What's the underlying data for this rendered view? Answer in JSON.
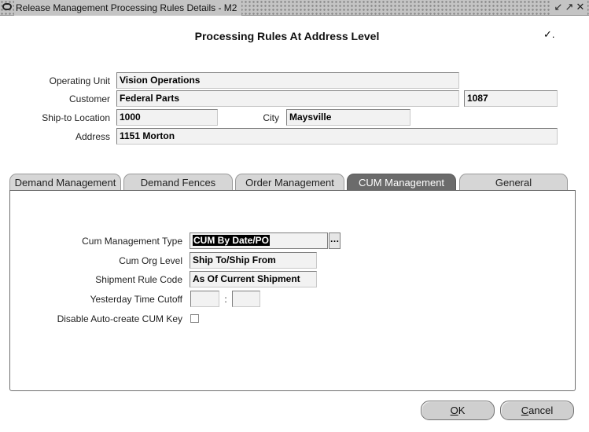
{
  "window": {
    "title": "Release Management Processing Rules Details - M2",
    "controls": [
      "↙",
      "↗",
      "✕"
    ]
  },
  "header": {
    "title": "Processing Rules At Address Level",
    "flag_mark": "✓."
  },
  "address": {
    "operating_unit_label": "Operating Unit",
    "operating_unit_value": "Vision Operations",
    "customer_label": "Customer",
    "customer_value": "Federal Parts",
    "customer_number": "1087",
    "ship_to_label": "Ship-to Location",
    "ship_to_value": "1000",
    "city_label": "City",
    "city_value": "Maysville",
    "address_label": "Address",
    "address_value": "1151 Morton"
  },
  "tabs": [
    {
      "label": "Demand Management",
      "active": false
    },
    {
      "label": "Demand Fences",
      "active": false
    },
    {
      "label": "Order Management",
      "active": false
    },
    {
      "label": "CUM Management",
      "active": true
    },
    {
      "label": "General",
      "active": false
    }
  ],
  "cum": {
    "type_label": "Cum Management Type",
    "type_value": "CUM By Date/PO",
    "lov_icon": "list-of-values-icon",
    "lov_glyph": "…",
    "org_level_label": "Cum Org Level",
    "org_level_value": "Ship To/Ship From",
    "shipment_rule_label": "Shipment Rule Code",
    "shipment_rule_value": "As Of Current Shipment",
    "cutoff_label": "Yesterday Time Cutoff",
    "cutoff_hours": "",
    "cutoff_separator": ":",
    "cutoff_minutes": "",
    "disable_label": "Disable Auto-create CUM Key",
    "disable_checked": false
  },
  "buttons": {
    "ok_mnemonic": "O",
    "ok_rest": "K",
    "cancel_mnemonic": "C",
    "cancel_rest": "ancel"
  },
  "colors": {
    "active_tab": "#6b6b6b",
    "inactive_tab": "#d6d6d6",
    "field_bg": "#f2f2f2"
  }
}
